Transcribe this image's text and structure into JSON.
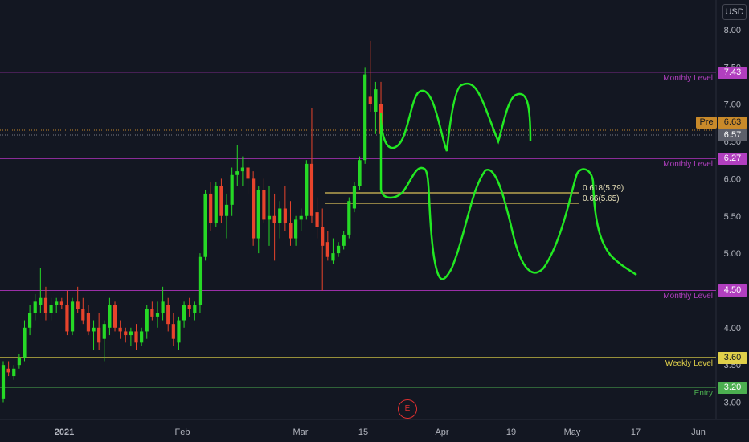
{
  "currency": "USD",
  "price_axis": {
    "ticks": [
      "8.00",
      "7.50",
      "7.00",
      "6.50",
      "6.00",
      "5.50",
      "5.00",
      "4.50",
      "4.00",
      "3.50",
      "3.00"
    ]
  },
  "time_axis": {
    "labels": [
      "2021",
      "Feb",
      "Mar",
      "15",
      "Apr",
      "19",
      "May",
      "17",
      "Jun"
    ]
  },
  "levels": [
    {
      "name": "Monthly Level",
      "value": "7.43",
      "color": "#b13fbf",
      "line_color": "#9b2fa8"
    },
    {
      "name": "Monthly Level",
      "value": "6.27",
      "color": "#b13fbf",
      "line_color": "#9b2fa8"
    },
    {
      "name": "Monthly Level",
      "value": "4.50",
      "color": "#b13fbf",
      "line_color": "#9b2fa8"
    },
    {
      "name": "Weekly Level",
      "value": "3.60",
      "color": "#e0d04a",
      "line_color": "#e6d84a"
    },
    {
      "name": "Entry",
      "value": "3.20",
      "color": "#4caf50",
      "line_color": "#4caf50"
    }
  ],
  "pre_market": {
    "label": "Pre",
    "value": "6.63",
    "color": "#c98a2a"
  },
  "last_price": {
    "value": "6.57",
    "color": "#5d606b"
  },
  "fib": [
    {
      "label": "0.618(5.79)",
      "value": 5.79
    },
    {
      "label": "0.66(5.65)",
      "value": 5.65
    }
  ],
  "event_marker": "E",
  "chart_data": {
    "type": "candlestick",
    "ylim": [
      2.75,
      8.2
    ],
    "candles_ohlc": [
      [
        3.05,
        3.55,
        3.0,
        3.5
      ],
      [
        3.45,
        3.55,
        3.35,
        3.4
      ],
      [
        3.35,
        3.5,
        3.3,
        3.45
      ],
      [
        3.5,
        3.65,
        3.45,
        3.6
      ],
      [
        3.6,
        4.1,
        3.55,
        4.0
      ],
      [
        4.0,
        4.3,
        3.9,
        4.2
      ],
      [
        4.2,
        4.45,
        4.1,
        4.35
      ],
      [
        4.3,
        4.8,
        4.2,
        4.4
      ],
      [
        4.4,
        4.55,
        4.1,
        4.2
      ],
      [
        4.2,
        4.4,
        4.1,
        4.3
      ],
      [
        4.3,
        4.4,
        4.2,
        4.35
      ],
      [
        4.35,
        4.4,
        4.25,
        4.3
      ],
      [
        4.3,
        4.5,
        3.9,
        3.95
      ],
      [
        3.95,
        4.4,
        3.9,
        4.35
      ],
      [
        4.35,
        4.55,
        4.2,
        4.25
      ],
      [
        4.25,
        4.4,
        4.05,
        4.1
      ],
      [
        4.2,
        4.3,
        3.9,
        3.95
      ],
      [
        3.95,
        4.1,
        3.7,
        4.0
      ],
      [
        4.0,
        4.2,
        3.7,
        3.8
      ],
      [
        3.85,
        4.1,
        3.55,
        4.05
      ],
      [
        4.0,
        4.4,
        3.9,
        4.3
      ],
      [
        4.3,
        4.35,
        3.95,
        4.0
      ],
      [
        4.0,
        4.1,
        3.85,
        3.95
      ],
      [
        3.95,
        4.0,
        3.8,
        3.9
      ],
      [
        3.9,
        4.0,
        3.75,
        3.95
      ],
      [
        3.95,
        4.05,
        3.7,
        3.8
      ],
      [
        3.8,
        4.0,
        3.75,
        3.95
      ],
      [
        3.95,
        4.3,
        3.85,
        4.25
      ],
      [
        4.25,
        4.35,
        4.1,
        4.15
      ],
      [
        4.15,
        4.35,
        4.0,
        4.2
      ],
      [
        4.2,
        4.55,
        4.1,
        4.35
      ],
      [
        4.3,
        4.4,
        3.95,
        4.05
      ],
      [
        4.05,
        4.2,
        3.75,
        3.85
      ],
      [
        3.8,
        4.15,
        3.7,
        4.1
      ],
      [
        4.1,
        4.35,
        4.0,
        4.3
      ],
      [
        4.3,
        4.4,
        4.15,
        4.25
      ],
      [
        4.2,
        4.35,
        4.1,
        4.3
      ],
      [
        4.3,
        5.0,
        4.2,
        4.95
      ],
      [
        4.95,
        5.85,
        4.9,
        5.8
      ],
      [
        5.8,
        5.95,
        5.3,
        5.4
      ],
      [
        5.4,
        5.95,
        5.35,
        5.9
      ],
      [
        5.9,
        6.0,
        5.4,
        5.5
      ],
      [
        5.5,
        5.8,
        5.2,
        5.65
      ],
      [
        5.65,
        6.15,
        5.5,
        6.05
      ],
      [
        6.05,
        6.45,
        5.9,
        6.1
      ],
      [
        6.1,
        6.3,
        5.9,
        6.15
      ],
      [
        6.15,
        6.3,
        5.8,
        6.0
      ],
      [
        6.0,
        6.1,
        5.1,
        5.2
      ],
      [
        5.2,
        5.9,
        5.0,
        5.85
      ],
      [
        5.85,
        6.0,
        5.4,
        5.45
      ],
      [
        5.45,
        5.9,
        5.1,
        5.5
      ],
      [
        5.5,
        5.8,
        4.9,
        5.4
      ],
      [
        5.4,
        5.7,
        5.2,
        5.6
      ],
      [
        5.6,
        5.9,
        5.3,
        5.4
      ],
      [
        5.4,
        5.7,
        5.1,
        5.2
      ],
      [
        5.2,
        5.5,
        5.1,
        5.45
      ],
      [
        5.45,
        5.6,
        5.3,
        5.5
      ],
      [
        5.5,
        6.25,
        5.45,
        6.2
      ],
      [
        6.2,
        6.95,
        5.4,
        5.5
      ],
      [
        5.55,
        5.75,
        5.2,
        5.35
      ],
      [
        5.35,
        5.6,
        4.5,
        5.1
      ],
      [
        5.15,
        5.3,
        4.9,
        4.95
      ],
      [
        4.9,
        5.2,
        4.85,
        5.0
      ],
      [
        5.0,
        5.15,
        4.95,
        5.1
      ],
      [
        5.1,
        5.3,
        5.05,
        5.25
      ],
      [
        5.25,
        5.75,
        5.2,
        5.7
      ],
      [
        5.6,
        5.95,
        5.55,
        5.9
      ],
      [
        5.9,
        6.3,
        5.85,
        6.25
      ],
      [
        6.25,
        7.5,
        6.2,
        7.4
      ],
      [
        7.1,
        7.85,
        6.9,
        7.0
      ],
      [
        6.9,
        7.3,
        6.6,
        7.2
      ],
      [
        7.0,
        7.3,
        6.5,
        6.6
      ]
    ]
  }
}
